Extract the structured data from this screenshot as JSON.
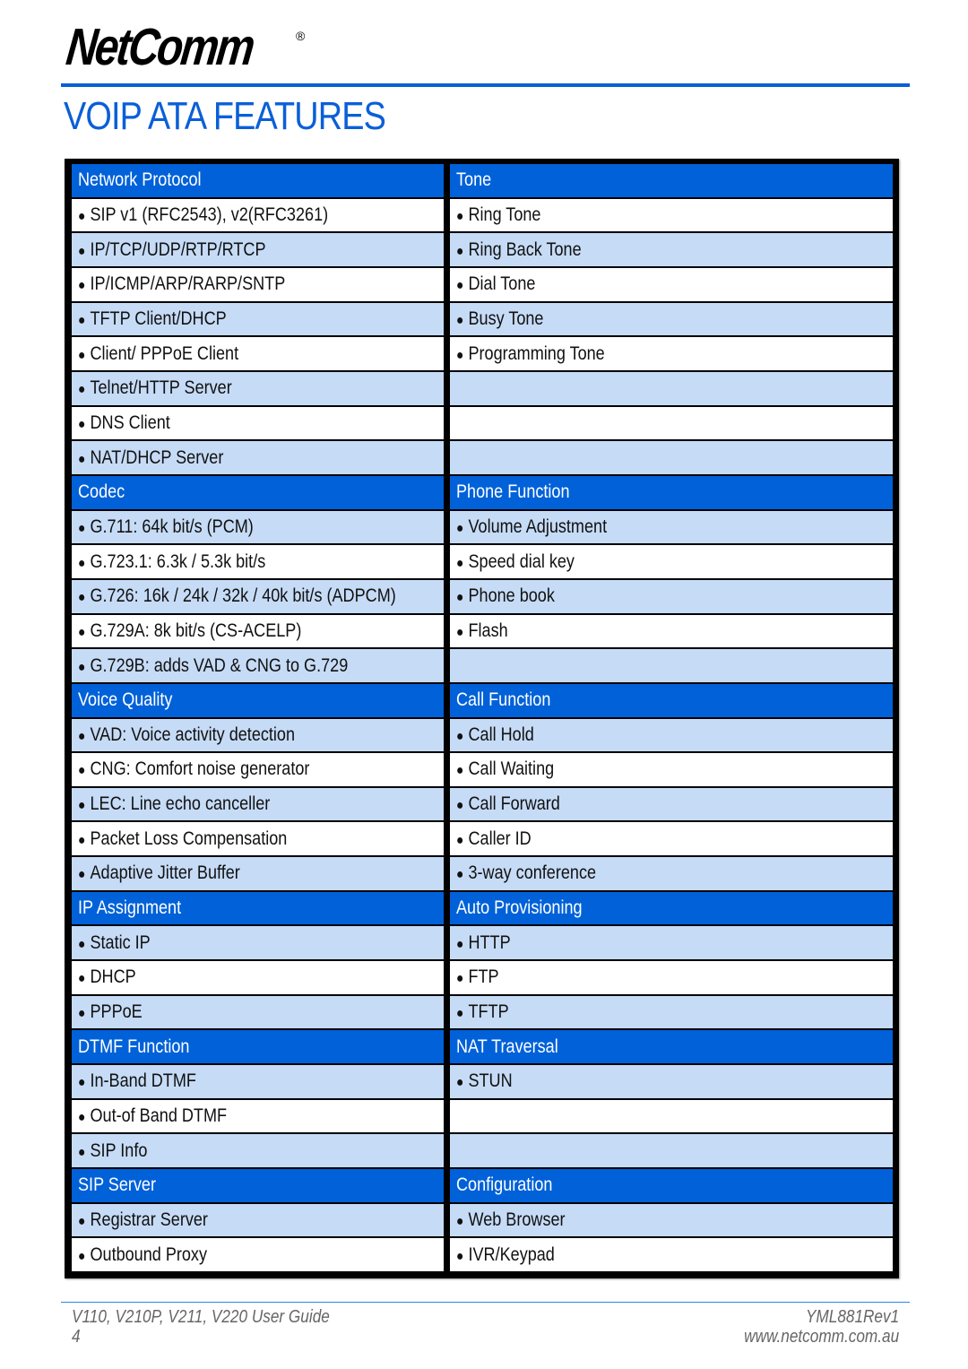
{
  "brand": {
    "logo_text": "NetComm",
    "registered_mark": "®",
    "accent_color": "#0a5fd8"
  },
  "page_title": "VOIP ATA FEATURES",
  "table": {
    "colors": {
      "header": "#0061d9",
      "row_alt": "#c6dbf6",
      "row": "#ffffff",
      "frame": "#000000"
    },
    "left_column": [
      {
        "type": "header",
        "text": "Network Protocol"
      },
      {
        "type": "item",
        "text": "SIP v1 (RFC2543), v2(RFC3261)",
        "shade": "white"
      },
      {
        "type": "item",
        "text": "IP/TCP/UDP/RTP/RTCP",
        "shade": "blue"
      },
      {
        "type": "item",
        "text": "IP/ICMP/ARP/RARP/SNTP",
        "shade": "white"
      },
      {
        "type": "item",
        "text": "TFTP Client/DHCP",
        "shade": "blue"
      },
      {
        "type": "item",
        "text": "Client/ PPPoE Client",
        "shade": "white"
      },
      {
        "type": "item",
        "text": "Telnet/HTTP Server",
        "shade": "blue"
      },
      {
        "type": "item",
        "text": "DNS Client",
        "shade": "white"
      },
      {
        "type": "item",
        "text": "NAT/DHCP Server",
        "shade": "blue"
      },
      {
        "type": "header",
        "text": "Codec"
      },
      {
        "type": "item",
        "text": "G.711: 64k bit/s (PCM)",
        "shade": "blue"
      },
      {
        "type": "item",
        "text": "G.723.1: 6.3k / 5.3k bit/s",
        "shade": "white"
      },
      {
        "type": "item",
        "text": "G.726: 16k / 24k / 32k / 40k bit/s (ADPCM)",
        "shade": "blue"
      },
      {
        "type": "item",
        "text": "G.729A: 8k bit/s (CS-ACELP)",
        "shade": "white"
      },
      {
        "type": "item",
        "text": "G.729B: adds VAD & CNG to G.729",
        "shade": "blue"
      },
      {
        "type": "header",
        "text": "Voice Quality"
      },
      {
        "type": "item",
        "text": "VAD: Voice activity detection",
        "shade": "blue"
      },
      {
        "type": "item",
        "text": "CNG: Comfort noise generator",
        "shade": "white"
      },
      {
        "type": "item",
        "text": "LEC: Line echo canceller",
        "shade": "blue"
      },
      {
        "type": "item",
        "text": "Packet Loss Compensation",
        "shade": "white"
      },
      {
        "type": "item",
        "text": "Adaptive Jitter Buffer",
        "shade": "blue"
      },
      {
        "type": "header",
        "text": "IP Assignment"
      },
      {
        "type": "item",
        "text": "Static IP",
        "shade": "blue"
      },
      {
        "type": "item",
        "text": "DHCP",
        "shade": "white"
      },
      {
        "type": "item",
        "text": "PPPoE",
        "shade": "blue"
      },
      {
        "type": "header",
        "text": "DTMF Function"
      },
      {
        "type": "item",
        "text": "In-Band DTMF",
        "shade": "blue"
      },
      {
        "type": "item",
        "text": "Out-of Band DTMF",
        "shade": "white"
      },
      {
        "type": "item",
        "text": "SIP Info",
        "shade": "blue"
      },
      {
        "type": "header",
        "text": "SIP Server"
      },
      {
        "type": "item",
        "text": "Registrar Server",
        "shade": "blue"
      },
      {
        "type": "item",
        "text": "Outbound Proxy",
        "shade": "white"
      }
    ],
    "right_column": [
      {
        "type": "header",
        "text": "Tone"
      },
      {
        "type": "item",
        "text": "Ring Tone",
        "shade": "white"
      },
      {
        "type": "item",
        "text": "Ring Back Tone",
        "shade": "blue"
      },
      {
        "type": "item",
        "text": "Dial Tone",
        "shade": "white"
      },
      {
        "type": "item",
        "text": "Busy Tone",
        "shade": "blue"
      },
      {
        "type": "item",
        "text": "Programming Tone",
        "shade": "white"
      },
      {
        "type": "empty",
        "text": "",
        "shade": "blue"
      },
      {
        "type": "empty",
        "text": "",
        "shade": "white"
      },
      {
        "type": "empty",
        "text": "",
        "shade": "blue"
      },
      {
        "type": "header",
        "text": "Phone Function"
      },
      {
        "type": "item",
        "text": "Volume Adjustment",
        "shade": "blue"
      },
      {
        "type": "item",
        "text": "Speed dial key",
        "shade": "white"
      },
      {
        "type": "item",
        "text": "Phone book",
        "shade": "blue"
      },
      {
        "type": "item",
        "text": "Flash",
        "shade": "white"
      },
      {
        "type": "empty",
        "text": "",
        "shade": "blue"
      },
      {
        "type": "header",
        "text": "Call Function"
      },
      {
        "type": "item",
        "text": "Call Hold",
        "shade": "blue"
      },
      {
        "type": "item",
        "text": "Call Waiting",
        "shade": "white"
      },
      {
        "type": "item",
        "text": "Call Forward",
        "shade": "blue"
      },
      {
        "type": "item",
        "text": "Caller ID",
        "shade": "white"
      },
      {
        "type": "item",
        "text": "3-way conference",
        "shade": "blue"
      },
      {
        "type": "header",
        "text": "Auto Provisioning"
      },
      {
        "type": "item",
        "text": "HTTP",
        "shade": "blue"
      },
      {
        "type": "item",
        "text": "FTP",
        "shade": "white"
      },
      {
        "type": "item",
        "text": "TFTP",
        "shade": "blue"
      },
      {
        "type": "header",
        "text": "NAT Traversal"
      },
      {
        "type": "item",
        "text": "STUN",
        "shade": "blue"
      },
      {
        "type": "empty",
        "text": "",
        "shade": "white"
      },
      {
        "type": "empty",
        "text": "",
        "shade": "blue"
      },
      {
        "type": "header",
        "text": "Configuration"
      },
      {
        "type": "item",
        "text": "Web Browser",
        "shade": "blue"
      },
      {
        "type": "item",
        "text": "IVR/Keypad",
        "shade": "white"
      }
    ]
  },
  "footer": {
    "guide_title": "V110, V210P, V211, V220 User Guide",
    "page_number": "4",
    "doc_code": "YML881Rev1",
    "website": "www.netcomm.com.au"
  }
}
